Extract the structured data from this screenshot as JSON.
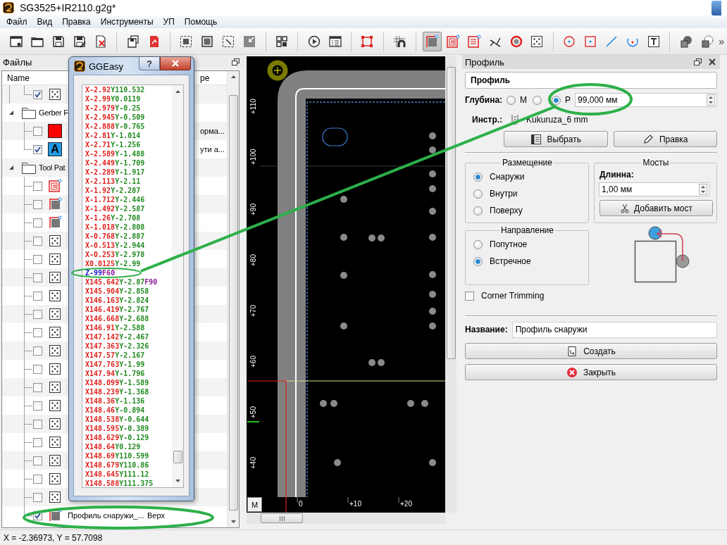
{
  "window": {
    "title": "SG3525+IR2110.g2g*"
  },
  "menu": [
    "Файл",
    "Вид",
    "Правка",
    "Инструменты",
    "УП",
    "Помощь"
  ],
  "toolbar": {
    "groups": [
      [
        {
          "kind": "new",
          "selected": false
        },
        {
          "kind": "open",
          "selected": false
        },
        {
          "kind": "save",
          "selected": false
        },
        {
          "kind": "save_as",
          "selected": false
        },
        {
          "kind": "close_file",
          "selected": false
        }
      ],
      [
        {
          "kind": "save_all",
          "selected": false
        },
        {
          "kind": "export",
          "selected": false
        }
      ],
      [
        {
          "kind": "zoom_fit",
          "selected": false
        },
        {
          "kind": "zoom_board",
          "selected": false
        },
        {
          "kind": "zoom_select",
          "selected": false
        },
        {
          "kind": "zoom_out",
          "selected": false
        }
      ],
      [
        {
          "kind": "qr",
          "selected": false
        }
      ],
      [
        {
          "kind": "run",
          "selected": false
        },
        {
          "kind": "gcode",
          "selected": false
        }
      ],
      [
        {
          "kind": "bounding",
          "selected": false
        }
      ],
      [
        {
          "kind": "hatch",
          "selected": false
        }
      ],
      [
        {
          "kind": "profile",
          "selected": true
        },
        {
          "kind": "pocket",
          "selected": false
        },
        {
          "kind": "raster",
          "selected": false
        },
        {
          "kind": "voronoi",
          "selected": false
        },
        {
          "kind": "thermal",
          "selected": false
        },
        {
          "kind": "drill",
          "selected": false
        }
      ],
      [
        {
          "kind": "circle",
          "selected": false
        },
        {
          "kind": "point",
          "selected": false
        },
        {
          "kind": "line",
          "selected": false
        },
        {
          "kind": "arc",
          "selected": false
        },
        {
          "kind": "text",
          "selected": false
        }
      ],
      [
        {
          "kind": "union",
          "selected": false
        },
        {
          "kind": "difference",
          "selected": false
        }
      ]
    ],
    "overflow": "»"
  },
  "files": {
    "title": "Файлы",
    "columns": [
      "Name",
      "pe"
    ],
    "orphan_children": [
      {
        "kind": "drill",
        "checked": true
      }
    ],
    "groups": [
      {
        "label": "Gerber F",
        "expanded": true,
        "children": [
          {
            "kind": "layer",
            "color": "#ff0000",
            "checked": false,
            "type_tail": "орма..."
          },
          {
            "kind": "layer",
            "color": "#1e9be6",
            "glyph": "A",
            "checked": true,
            "type_tail": "ути а..."
          }
        ]
      },
      {
        "label": "Tool Pat",
        "expanded": true,
        "children": [
          {
            "kind": "pocket",
            "checked": false
          },
          {
            "kind": "profile",
            "checked": false
          },
          {
            "kind": "profile",
            "checked": false
          },
          {
            "kind": "drill",
            "checked": false
          },
          {
            "kind": "drill",
            "checked": false
          },
          {
            "kind": "drill",
            "checked": false
          },
          {
            "kind": "drill",
            "checked": false
          },
          {
            "kind": "drill",
            "checked": false
          },
          {
            "kind": "drill",
            "checked": false
          },
          {
            "kind": "drill",
            "checked": false
          },
          {
            "kind": "drill",
            "checked": false
          },
          {
            "kind": "drill",
            "checked": false
          },
          {
            "kind": "drill",
            "checked": false
          },
          {
            "kind": "drill",
            "checked": false
          },
          {
            "kind": "drill",
            "checked": false
          },
          {
            "kind": "drill",
            "checked": false
          },
          {
            "kind": "drill",
            "checked": false
          },
          {
            "kind": "drill",
            "checked": false
          },
          {
            "kind": "profile",
            "checked": true,
            "label": "Профиль снаружи_...",
            "type": "Верх"
          }
        ]
      }
    ]
  },
  "dialog": {
    "title": "GGEasy",
    "help": "?",
    "lines": [
      {
        "x": "X-2.92",
        "y": "Y110.532"
      },
      {
        "x": "X-2.99",
        "y": "Y0.0119"
      },
      {
        "x": "X-2.979",
        "y": "Y-0.25"
      },
      {
        "x": "X-2.945",
        "y": "Y-0.509"
      },
      {
        "x": "X-2.888",
        "y": "Y-0.765"
      },
      {
        "x": "X-2.81",
        "y": "Y-1.014"
      },
      {
        "x": "X-2.71",
        "y": "Y-1.256"
      },
      {
        "x": "X-2.589",
        "y": "Y-1.488"
      },
      {
        "x": "X-2.449",
        "y": "Y-1.709"
      },
      {
        "x": "X-2.289",
        "y": "Y-1.917"
      },
      {
        "x": "X-2.113",
        "y": "Y-2.11"
      },
      {
        "x": "X-1.92",
        "y": "Y-2.287"
      },
      {
        "x": "X-1.712",
        "y": "Y-2.446"
      },
      {
        "x": "X-1.492",
        "y": "Y-2.587"
      },
      {
        "x": "X-1.26",
        "y": "Y-2.708"
      },
      {
        "x": "X-1.018",
        "y": "Y-2.808"
      },
      {
        "x": "X-0.768",
        "y": "Y-2.887"
      },
      {
        "x": "X-0.513",
        "y": "Y-2.944"
      },
      {
        "x": "X-0.253",
        "y": "Y-2.978"
      },
      {
        "x": "X0.0125",
        "y": "Y-2.99"
      },
      {
        "z": "Z-99",
        "f": "F60"
      },
      {
        "x": "X145.642",
        "y": "Y-2.87",
        "f": "F90"
      },
      {
        "x": "X145.904",
        "y": "Y-2.858"
      },
      {
        "x": "X146.163",
        "y": "Y-2.824"
      },
      {
        "x": "X146.419",
        "y": "Y-2.767"
      },
      {
        "x": "X146.668",
        "y": "Y-2.688"
      },
      {
        "x": "X146.91",
        "y": "Y-2.588"
      },
      {
        "x": "X147.142",
        "y": "Y-2.467"
      },
      {
        "x": "X147.363",
        "y": "Y-2.326"
      },
      {
        "x": "X147.57",
        "y": "Y-2.167"
      },
      {
        "x": "X147.763",
        "y": "Y-1.99"
      },
      {
        "x": "X147.94",
        "y": "Y-1.796"
      },
      {
        "x": "X148.099",
        "y": "Y-1.589"
      },
      {
        "x": "X148.239",
        "y": "Y-1.368"
      },
      {
        "x": "X148.36",
        "y": "Y-1.136"
      },
      {
        "x": "X148.46",
        "y": "Y-0.894"
      },
      {
        "x": "X148.538",
        "y": "Y-0.644"
      },
      {
        "x": "X148.595",
        "y": "Y-0.389"
      },
      {
        "x": "X148.629",
        "y": "Y-0.129"
      },
      {
        "x": "X148.64",
        "y": "Y0.129"
      },
      {
        "x": "X148.69",
        "y": "Y110.599"
      },
      {
        "x": "X148.679",
        "y": "Y110.86"
      },
      {
        "x": "X148.645",
        "y": "Y111.12"
      },
      {
        "x": "X148.588",
        "y": "Y111.375"
      }
    ]
  },
  "canvas": {
    "y_ruler": [
      "+110",
      "+100",
      "+90",
      "+80",
      "+70",
      "+60",
      "+50",
      "+40"
    ],
    "x_ruler": [
      "0",
      "+10",
      "+20"
    ],
    "mode_button": "M"
  },
  "profile_panel": {
    "title": "Профиль",
    "header": "Профиль",
    "depth": {
      "label": "Глубина:",
      "options": [
        {
          "label": "М",
          "selected": false
        },
        {
          "selected": false
        },
        {
          "label": "Р",
          "selected": true
        }
      ],
      "value": "99,000 мм"
    },
    "tool": {
      "label": "Инстр.:",
      "value": "Kukuruza_6 mm"
    },
    "tool_buttons": [
      {
        "kind": "select",
        "label": "Выбрать"
      },
      {
        "kind": "edit",
        "label": "Правка"
      }
    ],
    "placement": {
      "title": "Размещение",
      "options": [
        {
          "label": "Снаружи",
          "selected": true
        },
        {
          "label": "Внутри",
          "selected": false
        },
        {
          "label": "Поверху",
          "selected": false
        }
      ]
    },
    "bridges": {
      "title": "Мосты",
      "length_label": "Длинна:",
      "length": "1,00 мм",
      "add_button": "Добавить мост"
    },
    "direction": {
      "title": "Направление",
      "options": [
        {
          "label": "Попутное",
          "selected": false
        },
        {
          "label": "Встречное",
          "selected": true
        }
      ]
    },
    "corner_trimming": {
      "label": "Corner Trimming",
      "checked": false
    },
    "name": {
      "label": "Название:",
      "value": "Профиль снаружи"
    },
    "actions": [
      {
        "kind": "create",
        "label": "Создать"
      },
      {
        "kind": "close",
        "label": "Закрыть"
      }
    ]
  },
  "status_bar": "X = -2.36973, Y = 57.7098"
}
